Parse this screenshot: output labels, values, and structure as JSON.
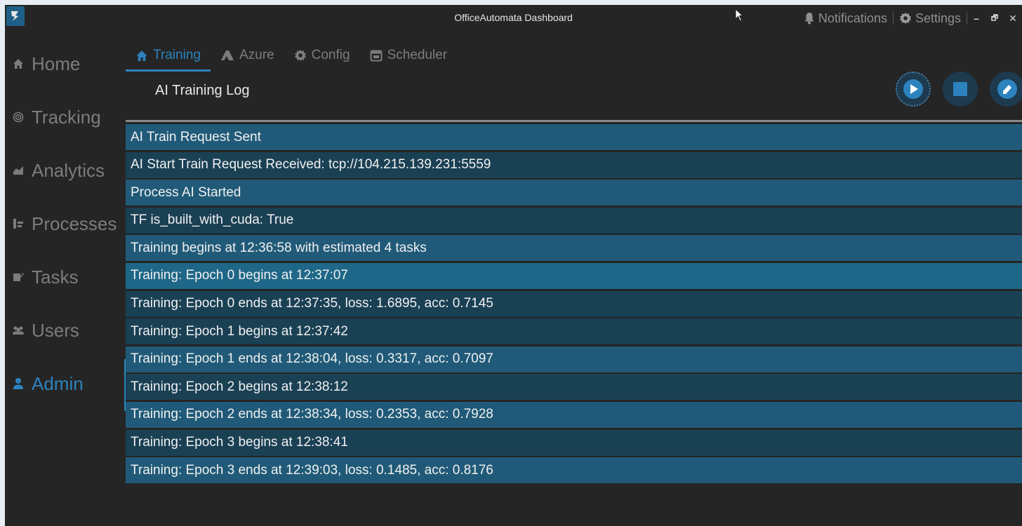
{
  "window": {
    "title": "OfficeAutomata Dashboard",
    "notifications_label": "Notifications",
    "settings_label": "Settings",
    "minimize": "–",
    "restore": "🗗",
    "close": "✕"
  },
  "sidebar": {
    "items": [
      {
        "label": "Home",
        "icon": "home-icon"
      },
      {
        "label": "Tracking",
        "icon": "target-icon"
      },
      {
        "label": "Analytics",
        "icon": "area-chart-icon"
      },
      {
        "label": "Processes",
        "icon": "process-icon"
      },
      {
        "label": "Tasks",
        "icon": "tasks-icon"
      },
      {
        "label": "Users",
        "icon": "users-icon"
      },
      {
        "label": "Admin",
        "icon": "user-icon",
        "active": true
      }
    ]
  },
  "tabs": [
    {
      "label": "Training",
      "icon": "home-icon",
      "active": true
    },
    {
      "label": "Azure",
      "icon": "azure-icon"
    },
    {
      "label": "Config",
      "icon": "gear-icon"
    },
    {
      "label": "Scheduler",
      "icon": "calendar-icon"
    }
  ],
  "panel": {
    "title": "AI Training Log",
    "buttons": [
      "play-button",
      "stop-button",
      "clear-button"
    ]
  },
  "log": [
    "AI Train Request Sent",
    "AI Start Train Request Received: tcp://104.215.139.231:5559",
    "Process AI Started",
    "TF is_built_with_cuda: True",
    "Training begins at 12:36:58 with estimated 4 tasks",
    "Training: Epoch 0 begins at 12:37:07",
    "Training: Epoch 0 ends at 12:37:35, loss: 1.6895, acc: 0.7145",
    "Training: Epoch 1 begins at 12:37:42",
    "Training: Epoch 1 ends at 12:38:04, loss: 0.3317, acc: 0.7097",
    "Training: Epoch 2 begins at 12:38:12",
    "Training: Epoch 2 ends at 12:38:34, loss: 0.2353, acc: 0.7928",
    "Training: Epoch 3 begins at 12:38:41",
    "Training: Epoch 3 ends at 12:39:03, loss: 0.1485, acc: 0.8176"
  ],
  "colors": {
    "accent": "#2c83be",
    "background": "#252525",
    "row_primary": "#205a78",
    "row_secondary": "#1a4054",
    "row_highlight": "#1e6788"
  }
}
